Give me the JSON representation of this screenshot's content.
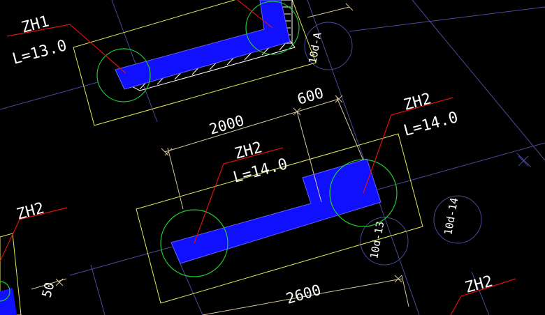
{
  "viewport": {
    "background": "#000000"
  },
  "colors": {
    "background": "#000000",
    "grid_axis": "#4a4a9a",
    "cap_outline": "#e8e85a",
    "pile_circle": "#22cc33",
    "beam_fill": "#1010ff",
    "leader": "#dd1010",
    "dimension": "#d8c8a0",
    "text": "#ffffff",
    "hatch": "#ffffff"
  },
  "labels": {
    "zh1_name": "ZH1",
    "zh1_length": "L=13.0",
    "zh2_top_name": "ZH2",
    "zh2_top_length": "L=14.0",
    "zh2_mid_name": "ZH2",
    "zh2_mid_length": "L=14.0",
    "zh2_left_name": "ZH2",
    "zh2_bottom_right_name": "ZH2",
    "axis_a": "10d-A",
    "axis_13": "10d-13",
    "axis_14": "10d-14"
  },
  "dimensions": {
    "dim_2000": "2000",
    "dim_600": "600",
    "dim_2600": "2600",
    "dim_50": "50"
  },
  "icons": {
    "dimension_tick": "cross-tick-icon",
    "pile": "pile-circle-icon"
  }
}
